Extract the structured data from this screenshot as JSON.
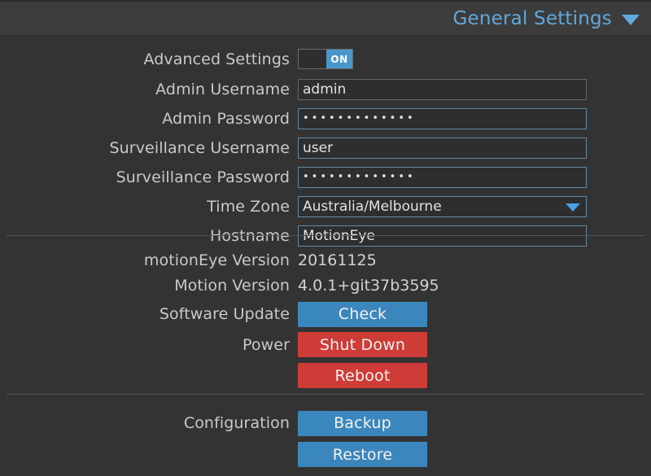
{
  "header": {
    "title": "General Settings",
    "caret_icon": "chevron-down-icon"
  },
  "settings": {
    "advanced_settings": {
      "label": "Advanced Settings",
      "state": "ON"
    },
    "admin_username": {
      "label": "Admin Username",
      "value": "admin"
    },
    "admin_password": {
      "label": "Admin Password",
      "value": "•••••••••••••"
    },
    "surveillance_username": {
      "label": "Surveillance Username",
      "value": "user"
    },
    "surveillance_password": {
      "label": "Surveillance Password",
      "value": "•••••••••••••"
    },
    "time_zone": {
      "label": "Time Zone",
      "value": "Australia/Melbourne",
      "caret_icon": "dropdown-arrow-icon"
    },
    "hostname": {
      "label": "Hostname",
      "value": "MotionEye"
    }
  },
  "system": {
    "motioneye_version": {
      "label": "motionEye Version",
      "value": "20161125"
    },
    "motion_version": {
      "label": "Motion Version",
      "value": "4.0.1+git37b3595"
    },
    "software_update": {
      "label": "Software Update",
      "check_button": "Check"
    },
    "power": {
      "label": "Power",
      "shutdown_button": "Shut Down",
      "reboot_button": "Reboot"
    }
  },
  "configuration": {
    "label": "Configuration",
    "backup_button": "Backup",
    "restore_button": "Restore"
  },
  "colors": {
    "accent_blue": "#3b86bd",
    "title_blue": "#62a8dd",
    "danger_red": "#cf3b36",
    "panel_bg": "#333333",
    "header_bg": "#3c3c3c",
    "input_bg": "#2e2e2e",
    "input_border": "#5f8ba8"
  }
}
